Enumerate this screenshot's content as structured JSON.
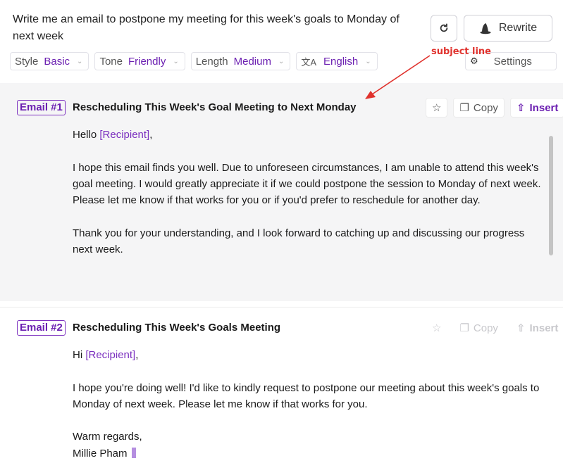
{
  "header": {
    "prompt": "Write me an email to postpone my meeting for this week's goals to Monday of next week",
    "rewrite_label": "Rewrite",
    "options": [
      {
        "key": "Style",
        "value": "Basic"
      },
      {
        "key": "Tone",
        "value": "Friendly"
      },
      {
        "key": "Length",
        "value": "Medium"
      }
    ],
    "language": "English",
    "settings_label": "Settings"
  },
  "annotation": {
    "text": "subject line",
    "color": "#e0322d"
  },
  "emails": [
    {
      "badge": "Email #1",
      "subject": "Rescheduling This Week's Goal Meeting to Next Monday",
      "greeting": "Hello",
      "recipient": "[Recipient]",
      "greeting_end": ",",
      "para1": "I hope this email finds you well. Due to unforeseen circumstances, I am unable to attend this week's goal meeting. I would greatly appreciate it if we could postpone the session to Monday of next week. Please let me know if that works for you or if you'd prefer to reschedule for another day.",
      "para2": "Thank you for your understanding, and I look forward to catching up and discussing our progress next week."
    },
    {
      "badge": "Email #2",
      "subject": "Rescheduling This Week's Goals Meeting",
      "greeting": "Hi",
      "recipient": "[Recipient]",
      "greeting_end": ",",
      "para1": "I hope you're doing well! I'd like to kindly request to postpone our meeting about this week's goals to Monday of next week. Please let me know if that works for you.",
      "signoff": "Warm regards,",
      "signature": "Millie Pham"
    }
  ],
  "actions": {
    "copy": "Copy",
    "insert": "Insert"
  },
  "colors": {
    "accent": "#6b1fb1",
    "annotation": "#e0322d"
  }
}
